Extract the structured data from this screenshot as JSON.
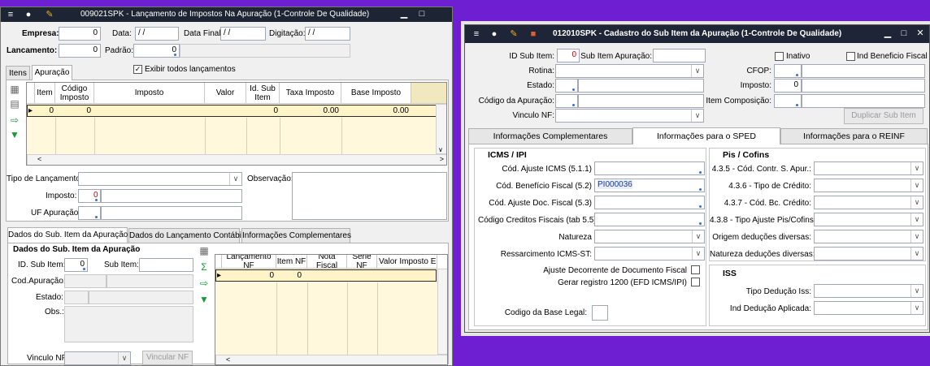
{
  "left": {
    "title": "009021SPK - Lançamento de Impostos Na Apuração (1-Controle De Qualidade)",
    "header": {
      "empresa_label": "Empresa:",
      "empresa_value": "0",
      "data_label": "Data:",
      "data_value": "/ /",
      "data_final_label": "Data Final:",
      "data_final_value": "/ /",
      "digitacao_label": "Digitação:",
      "digitacao_value": "/ /",
      "lancamento_label": "Lancamento:",
      "lancamento_value": "0",
      "padrao_label": "Padrão:",
      "padrao_value": "0"
    },
    "tabs": [
      "Itens",
      "Apuração"
    ],
    "exibir_label": "Exibir todos lançamentos",
    "grid": {
      "headers": [
        "Item",
        "Código Imposto",
        "Imposto",
        "Valor",
        "Id. Sub Item",
        "Taxa Imposto",
        "Base Imposto"
      ],
      "row": [
        "0",
        "0",
        "",
        "",
        "0",
        "0.00",
        "0.00"
      ]
    },
    "form": {
      "tipo_label": "Tipo de Lançamento:",
      "imposto_label": "Imposto:",
      "imposto_value": "0",
      "uf_label": "UF Apuração:",
      "obs_label": "Observação:"
    },
    "subtabs": [
      "Dados do Sub. Item da Apuração",
      "Dados do Lançamento Contábil",
      "Informações Complementares"
    ],
    "sub": {
      "section": "Dados do Sub. Item da Apuração",
      "id_label": "ID. Sub Item:",
      "id_value": "0",
      "sub_item_label": "Sub Item:",
      "cod_label": "Cod.Apuração:",
      "estado_label": "Estado:",
      "obs_label": "Obs.:",
      "vinculo_label": "Vinculo NF:",
      "vincular_btn": "Vincular NF"
    },
    "nf_grid": {
      "headers": [
        "Lançamento NF",
        "Item NF",
        "Nota Fiscal",
        "Serie NF",
        "Valor Imposto Em"
      ],
      "row": [
        "0",
        "0",
        "",
        "",
        ""
      ]
    }
  },
  "right": {
    "title": "012010SPK - Cadastro do Sub Item da Apuração (1-Controle De Qualidade)",
    "top": {
      "id_label": "ID Sub Item:",
      "id_value": "0",
      "sub_item_label": "Sub Item Apuração:",
      "inativo_label": "Inativo",
      "ind_beneficio_label": "Ind Beneficio Fiscal",
      "rotina_label": "Rotina:",
      "cfop_label": "CFOP:",
      "estado_label": "Estado:",
      "imposto_label": "Imposto:",
      "imposto_value": "0",
      "cod_apuracao_label": "Código da Apuração:",
      "item_comp_label": "Item Composição:",
      "vinculo_label": "Vinculo NF:",
      "duplicar_btn": "Duplicar Sub Item"
    },
    "tabs": [
      "Informações Complementares",
      "Informações para o SPED",
      "Informações para o REINF"
    ],
    "icms": {
      "title": "ICMS / IPI",
      "ajuste_label": "Cód. Ajuste ICMS (5.1.1)",
      "beneficio_label": "Cód. Benefício Fiscal (5.2)",
      "beneficio_value": "PI000036",
      "ajuste_doc_label": "Cód. Ajuste Doc. Fiscal (5.3)",
      "creditos_label": "Código Creditos Fiscais (tab 5.5)",
      "natureza_label": "Natureza",
      "ressarcimento_label": "Ressarcimento ICMS-ST:",
      "ajuste_decorrente_label": "Ajuste Decorrente de Documento Fiscal",
      "gerar_label": "Gerar registro 1200 (EFD ICMS/IPI)",
      "base_legal_label": "Codigo da Base Legal:"
    },
    "pis": {
      "title": "Pis / Cofins",
      "l1": "4.3.5 - Cód. Contr. S. Apur.:",
      "l2": "4.3.6 - Tipo de Crédito:",
      "l3": "4.3.7 - Cód. Bc. Crédito:",
      "l4": "4.3.8 - Tipo Ajuste Pis/Cofins:",
      "l5": "Origem deduções diversas:",
      "l6": "Natureza deduções diversas:"
    },
    "iss": {
      "title": "ISS",
      "tipo_label": "Tipo Dedução Iss:",
      "ind_label": "Ind Dedução Aplicada:"
    }
  }
}
